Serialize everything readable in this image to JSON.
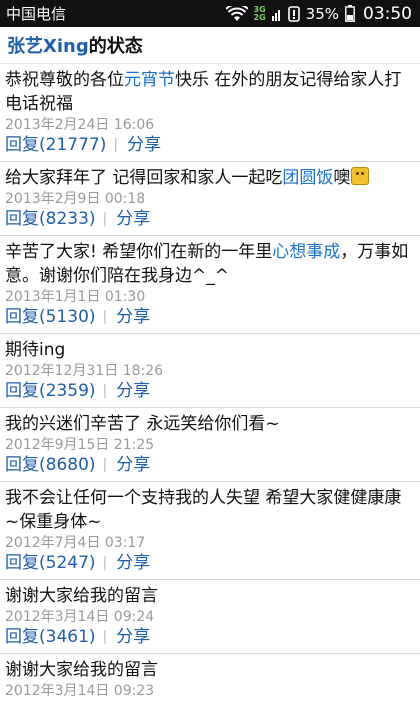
{
  "status_bar": {
    "carrier": "中国电信",
    "network_top": "3G",
    "network_bottom": "2G",
    "battery_percent": "35%",
    "time": "03:50"
  },
  "header": {
    "name": "张艺Xing",
    "suffix": "的状态"
  },
  "posts": [
    {
      "parts": [
        "恭祝尊敬的各位",
        "元宵节",
        "快乐 在外的朋友记得给家人打电话祝福"
      ],
      "time": "2013年2月24日 16:06",
      "reply": "回复(21777)",
      "share": "分享"
    },
    {
      "parts": [
        "给大家拜年了 记得回家和家人一起吃",
        "团圆饭",
        "噢"
      ],
      "time": "2013年2月9日 00:18",
      "reply": "回复(8233)",
      "share": "分享"
    },
    {
      "parts": [
        "辛苦了大家! 希望你们在新的一年里",
        "心想事成",
        "，万事如意。谢谢你们陪在我身边^_^"
      ],
      "time": "2013年1月1日 01:30",
      "reply": "回复(5130)",
      "share": "分享"
    },
    {
      "text": "期待ing",
      "time": "2012年12月31日 18:26",
      "reply": "回复(2359)",
      "share": "分享"
    },
    {
      "text": "我的兴迷们辛苦了 永远笑给你们看~",
      "time": "2012年9月15日 21:25",
      "reply": "回复(8680)",
      "share": "分享"
    },
    {
      "text": "我不会让任何一个支持我的人失望 希望大家健健康康~保重身体~",
      "time": "2012年7月4日 03:17",
      "reply": "回复(5247)",
      "share": "分享"
    },
    {
      "text": "谢谢大家给我的留言",
      "time": "2012年3月14日 09:24",
      "reply": "回复(3461)",
      "share": "分享"
    },
    {
      "text": "谢谢大家给我的留言",
      "time": "2012年3月14日 09:23"
    }
  ]
}
